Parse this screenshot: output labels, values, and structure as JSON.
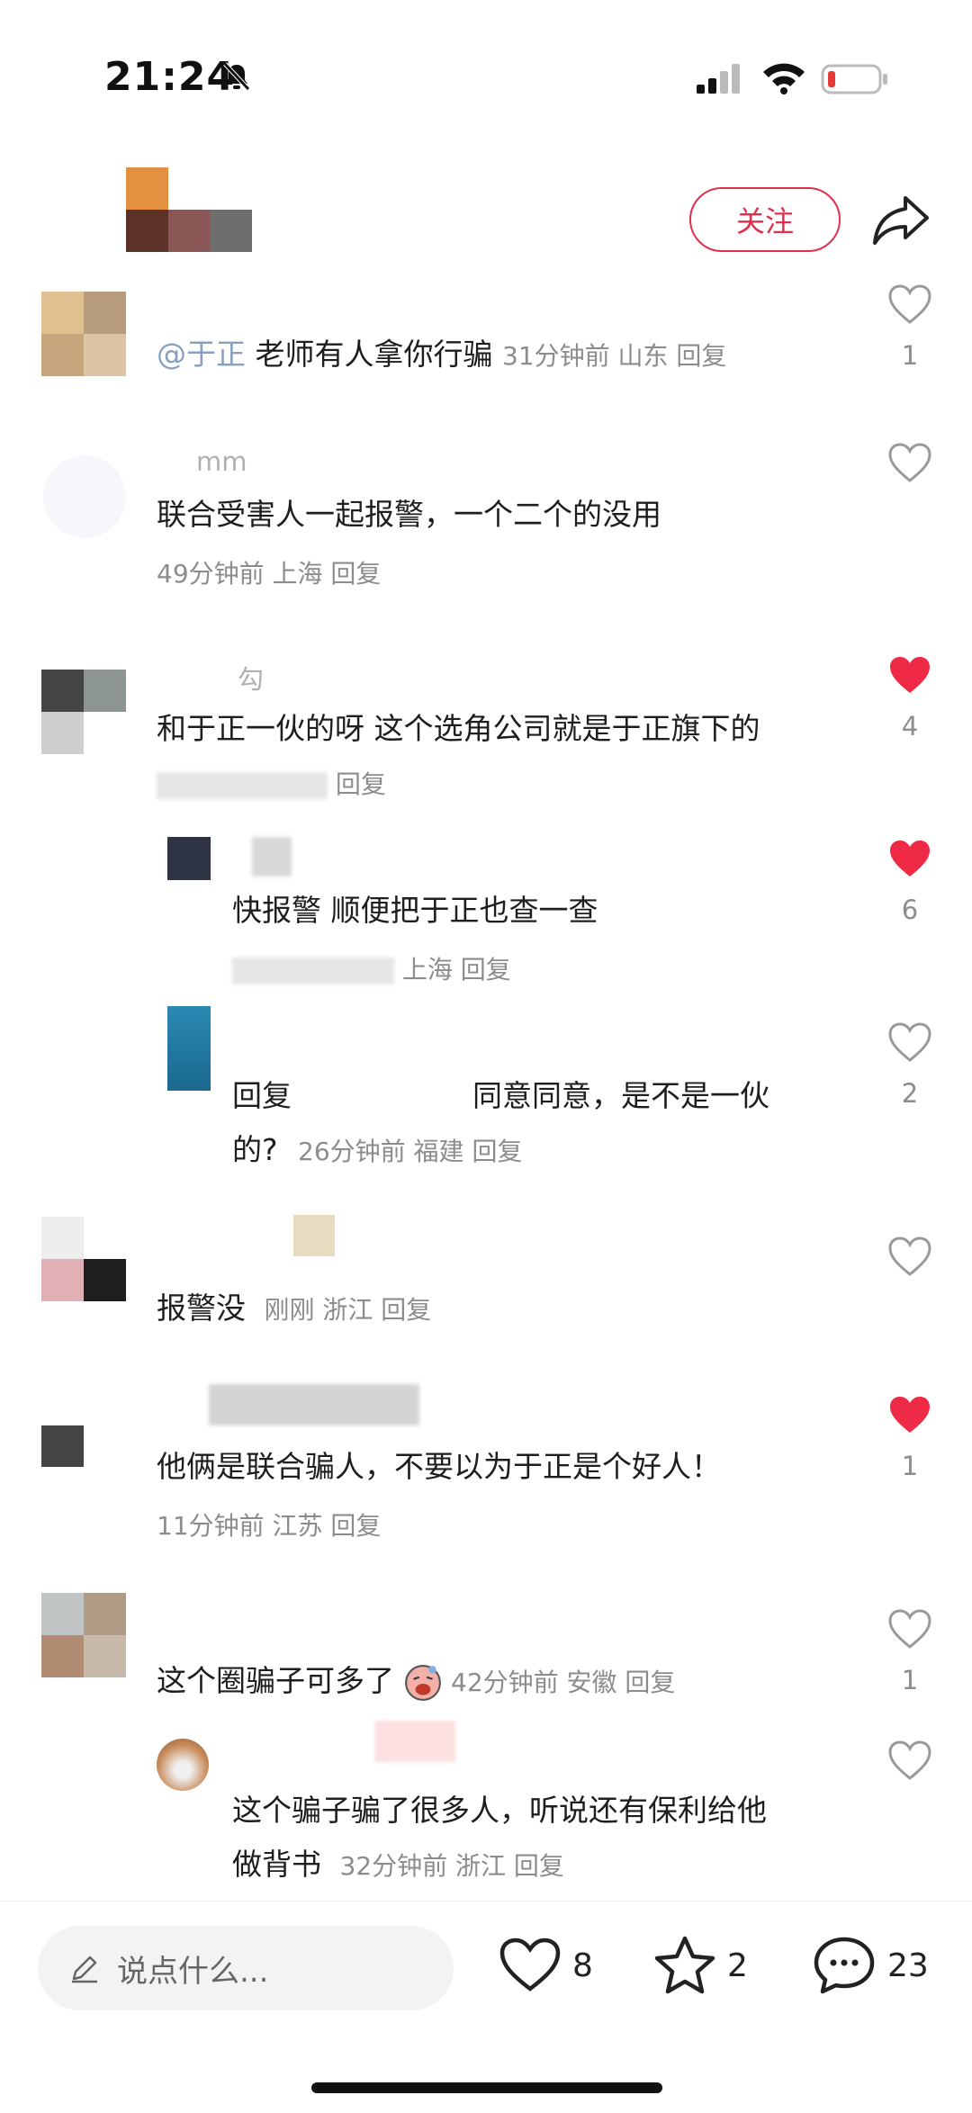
{
  "status_bar": {
    "time": "21:24"
  },
  "header": {
    "follow_label": "关注"
  },
  "comments": [
    {
      "mention": "@于正",
      "text": "老师有人拿你行骗",
      "meta": "31分钟前 山东 回复",
      "likes": "1",
      "liked": false
    },
    {
      "username": "mm",
      "text": "联合受害人一起报警，一个二个的没用",
      "meta": "49分钟前 上海 回复",
      "likes": "",
      "liked": false
    },
    {
      "username": "勾",
      "text": "和于正一伙的呀 这个选角公司就是于正旗下的",
      "meta": "回复",
      "likes": "4",
      "liked": true
    },
    {
      "text": "快报警 顺便把于正也查一查",
      "meta": "上海 回复",
      "likes": "6",
      "liked": true
    },
    {
      "text_line1_start": "回复",
      "text_line1_end": "同意同意，是不是一伙",
      "text_line2": "的?",
      "meta": "26分钟前 福建 回复",
      "likes": "2",
      "liked": false
    },
    {
      "text": "报警没",
      "meta": "刚刚 浙江 回复",
      "likes": "",
      "liked": false
    },
    {
      "text": "他俩是联合骗人，不要以为于正是个好人！",
      "meta": "11分钟前 江苏 回复",
      "likes": "1",
      "liked": true
    },
    {
      "text": "这个圈骗子可多了",
      "meta": "42分钟前 安徽 回复",
      "likes": "1",
      "liked": false
    },
    {
      "text_line1": "这个骗子骗了很多人，听说还有保利给他",
      "text_line2": "做背书",
      "meta": "32分钟前 浙江 回复",
      "likes": "",
      "liked": false
    }
  ],
  "bottom_bar": {
    "input_placeholder": "说点什么...",
    "like_count": "8",
    "star_count": "2",
    "comment_count": "23"
  },
  "colors": {
    "accent": "#e0304e",
    "liked_heart": "#ee2a46",
    "muted": "#8c8c8c"
  }
}
